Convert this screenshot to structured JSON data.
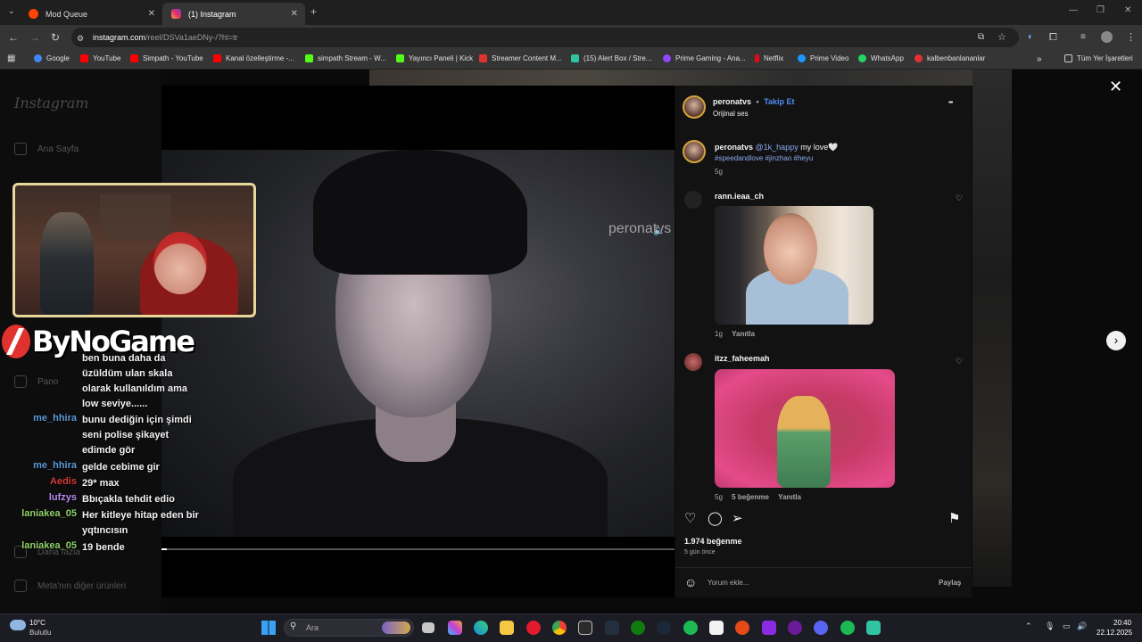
{
  "browser": {
    "tabs": [
      {
        "label": "Mod Queue",
        "close": "✕"
      },
      {
        "label": "(1) Instagram",
        "close": "✕"
      }
    ],
    "new_tab": "+",
    "url_host": "instagram.com",
    "url_path": "/reel/DSVa1aeDNy-/?hl=tr",
    "bookmarks": [
      {
        "label": "Google",
        "color": "#4285f4"
      },
      {
        "label": "YouTube",
        "color": "#ff0000"
      },
      {
        "label": "Simpath - YouTube",
        "color": "#ff0000"
      },
      {
        "label": "Kanal özelleştirme -...",
        "color": "#ff0000"
      },
      {
        "label": "simpath Stream - W...",
        "color": "#53fc18"
      },
      {
        "label": "Yayıncı Paneli | Kick",
        "color": "#53fc18"
      },
      {
        "label": "Streamer Content M...",
        "color": "#e0322e"
      },
      {
        "label": "(15) Alert Box / Stre...",
        "color": "#31c3a2"
      },
      {
        "label": "Prime Gaming - Ana...",
        "color": "#9146ff"
      },
      {
        "label": "Netflix",
        "color": "#e50914"
      },
      {
        "label": "Prime Video",
        "color": "#1a98ff"
      },
      {
        "label": "WhatsApp",
        "color": "#25d366"
      },
      {
        "label": "kalbenbanlananlar",
        "color": "#e0322e"
      }
    ],
    "all_bookmarks": "Tüm Yer İşaretleri",
    "more_bookmarks": "»"
  },
  "instagram": {
    "logo": "Instagram",
    "nav": {
      "home": "Ana Sayfa",
      "dashboard": "Pano",
      "more": "Daha fazla",
      "meta": "Meta'nın diğer ürünleri"
    }
  },
  "video": {
    "watermark": "peronatvs",
    "progress": 0.01
  },
  "stream_overlay": {
    "brand": "ByNoGame",
    "chat": [
      {
        "user": "",
        "message": "ben buna daha da",
        "color": "#ffffff"
      },
      {
        "user": "",
        "message": "üzüldüm ulan skala",
        "color": "#ffffff"
      },
      {
        "user": "",
        "message": "olarak kullanıldım ama",
        "color": "#ffffff"
      },
      {
        "user": "",
        "message": "low seviye......",
        "color": "#ffffff"
      },
      {
        "user": "me_hhira",
        "message": "bunu dediğin için şimdi",
        "color": "#5b9bd5"
      },
      {
        "user": "",
        "message": "seni polise şikayet",
        "color": "#ffffff"
      },
      {
        "user": "",
        "message": "edimde gör",
        "color": "#ffffff"
      },
      {
        "user": "me_hhira",
        "message": "gelde cebime gir",
        "color": "#5b9bd5"
      },
      {
        "user": "Aedis",
        "message": "29* max",
        "color": "#d63a3a"
      },
      {
        "user": "lufzys",
        "message": "Bbıçakla tehdit edio",
        "color": "#b98af0"
      },
      {
        "user": "laniakea_05",
        "message": "Her kitleye hitap eden bir",
        "color": "#8fd16a"
      },
      {
        "user": "",
        "message": "yqtıncısın",
        "color": "#ffffff"
      },
      {
        "user": "laniakea_05",
        "message": "19 bende",
        "color": "#8fd16a"
      }
    ]
  },
  "panel": {
    "author": "peronatvs",
    "dot": "•",
    "follow": "Takip Et",
    "audio": "Orijinal ses",
    "more": "•••",
    "caption": {
      "user": "peronatvs",
      "mention": "@1k_happy",
      "text": "my love🤍",
      "tags": "#speedandlove #jinzhao #heyu",
      "time": "5g"
    },
    "comments": [
      {
        "user": "rann.ieaa_ch",
        "time": "1g",
        "reply": "Yanıtla",
        "likes": ""
      },
      {
        "user": "itzz_faheemah",
        "time": "5g",
        "reply": "Yanıtla",
        "likes": "5 beğenme"
      }
    ],
    "likes": "1.974 beğenme",
    "posted": "5 gün önce",
    "comment_placeholder": "Yorum ekle...",
    "share": "Paylaş"
  },
  "taskbar": {
    "weather_temp": "10°C",
    "weather_desc": "Bulutlu",
    "search_placeholder": "Ara",
    "time": "20:40",
    "date": "22.12.2025"
  }
}
